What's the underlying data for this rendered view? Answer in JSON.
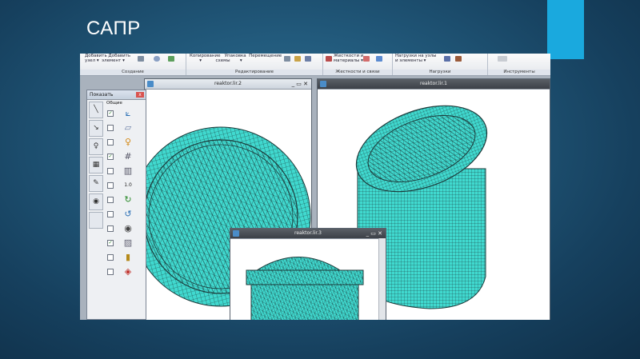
{
  "slide": {
    "title": "САПР"
  },
  "ribbon": {
    "groups": [
      {
        "label": "Создание",
        "buttons": [
          "Добавить Добавить\nузел ▾  элемент ▾"
        ]
      },
      {
        "label": "Редактирование",
        "buttons": [
          "Копирование   Упаковка  Перемещение\n       ▾          схемы       ▾"
        ]
      },
      {
        "label": "Жесткости и связи",
        "buttons": [
          "Жесткости и\nматериалы ▾"
        ]
      },
      {
        "label": "Нагрузки",
        "buttons": [
          "Нагрузки на узлы\nи элементы ▾"
        ]
      },
      {
        "label": "Инструменты",
        "buttons": []
      }
    ]
  },
  "panel": {
    "title": "Показать",
    "close": "x",
    "group": "Общие",
    "options": [
      {
        "checked": true,
        "icon": "axes-icon"
      },
      {
        "checked": false,
        "icon": "plate-icon"
      },
      {
        "checked": false,
        "icon": "node-icon"
      },
      {
        "checked": true,
        "icon": "grid-icon"
      },
      {
        "checked": false,
        "icon": "mesh-icon"
      },
      {
        "checked": false,
        "icon": "number-icon",
        "label": "1.0"
      },
      {
        "checked": false,
        "icon": "rotate-icon"
      },
      {
        "checked": false,
        "icon": "rotate-axis-icon"
      },
      {
        "checked": false,
        "icon": "eye-icon"
      },
      {
        "checked": true,
        "icon": "hatch-icon"
      },
      {
        "checked": false,
        "icon": "color-bars-icon"
      },
      {
        "checked": false,
        "icon": "cube-red-icon"
      }
    ]
  },
  "windows": [
    {
      "title": "reaktor.lir.2",
      "controls": "_  ▭  ✕"
    },
    {
      "title": "reaktor.lir.1",
      "controls": ""
    },
    {
      "title": "reaktor.lir.3",
      "controls": "_  ▭  ✕"
    }
  ],
  "colors": {
    "mesh_fill": "#40d9cf",
    "mesh_line": "#1c3a3a",
    "accent": "#1aa9de"
  }
}
